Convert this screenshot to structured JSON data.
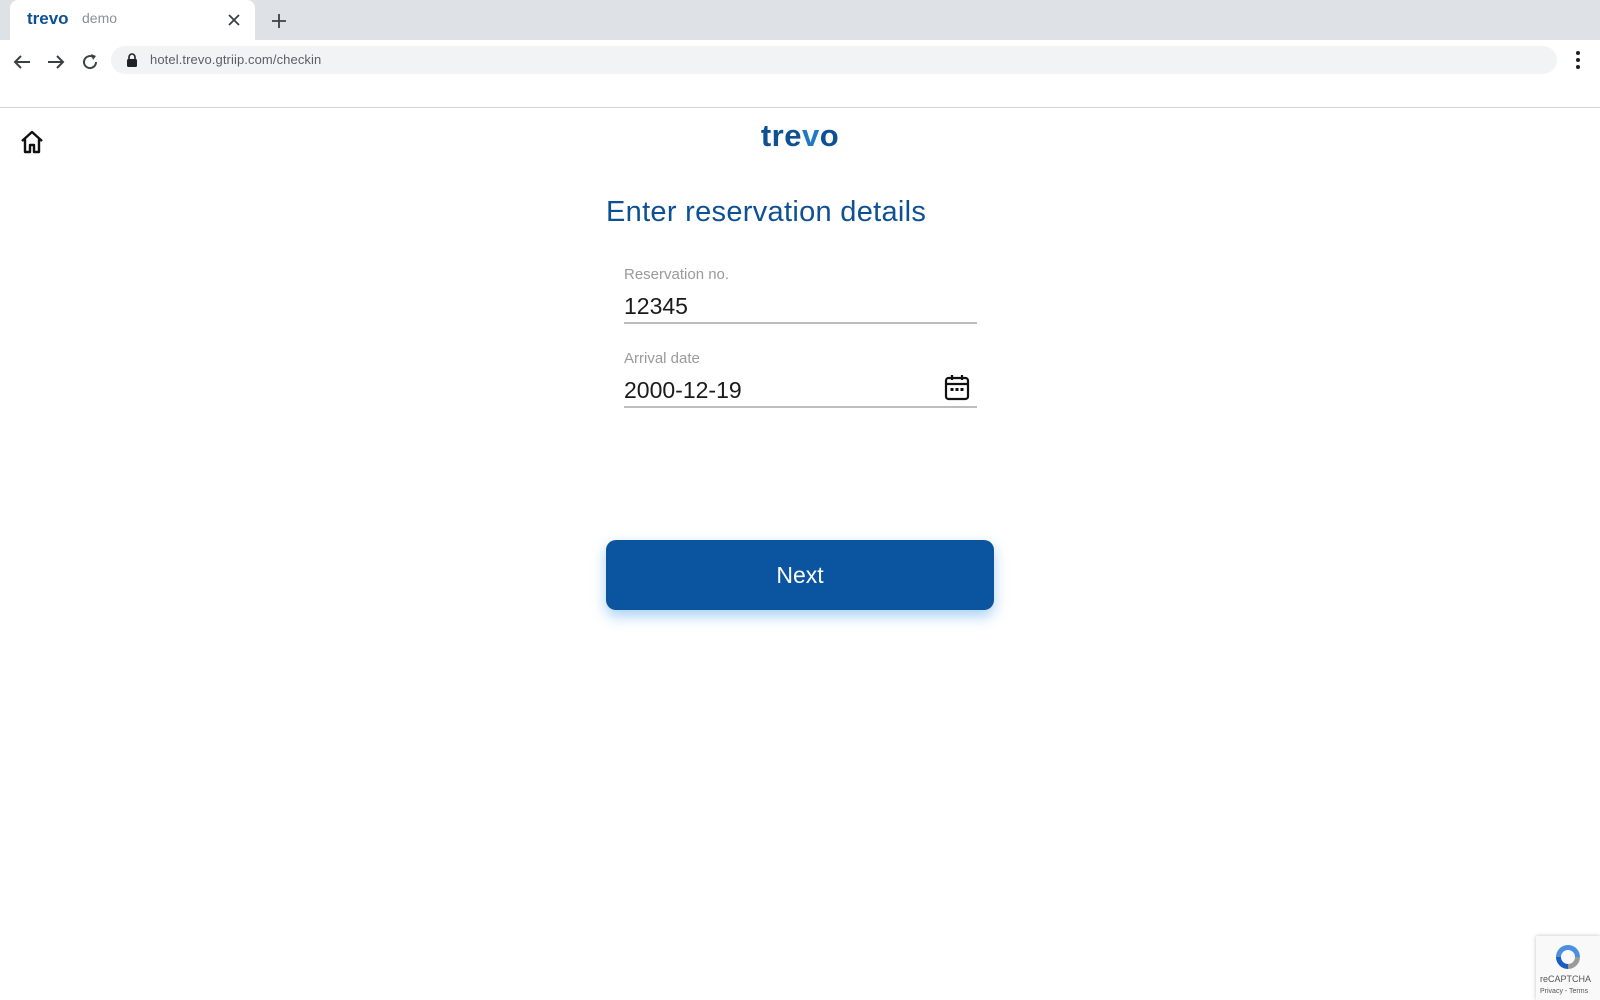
{
  "browser": {
    "tab": {
      "logo_text": "trevo",
      "label": "demo"
    },
    "url": "hotel.trevo.gtriip.com/checkin"
  },
  "page": {
    "logo": {
      "part1": "tre",
      "part2": "v",
      "part3": "o"
    },
    "heading": "Enter reservation details",
    "fields": {
      "reservation": {
        "label": "Reservation no.",
        "value": "12345"
      },
      "arrival": {
        "label": "Arrival date",
        "value": "2000-12-19"
      }
    },
    "next_label": "Next"
  },
  "recaptcha": {
    "label": "reCAPTCHA",
    "links": "Privacy - Terms"
  },
  "colors": {
    "brand": "#0d5094",
    "button": "#0b55a0",
    "accent": "#1f79c6"
  },
  "icons": [
    "close-icon",
    "plus-icon",
    "back-arrow-icon",
    "forward-arrow-icon",
    "reload-icon",
    "lock-icon",
    "kebab-menu-icon",
    "home-icon",
    "calendar-icon",
    "recaptcha-icon"
  ]
}
